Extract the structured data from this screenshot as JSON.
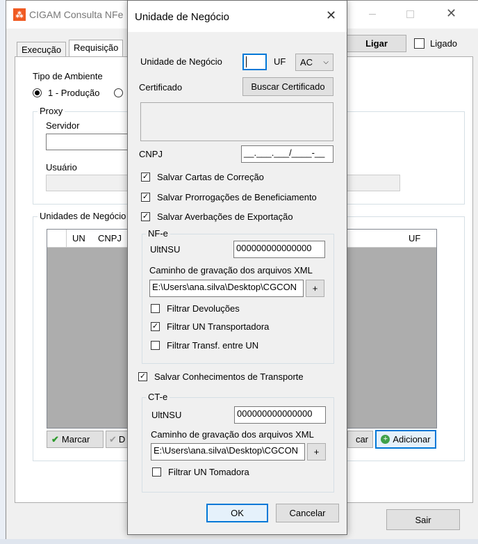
{
  "main_window": {
    "title": "CIGAM Consulta NFe",
    "tabs": [
      "Execução",
      "Requisição"
    ],
    "ligar_label": "Ligar",
    "ligado_label": "Ligado",
    "tipo_ambiente_label": "Tipo de Ambiente",
    "ambiente_option": "1 - Produção",
    "proxy_label": "Proxy",
    "servidor_label": "Servidor",
    "usuario_label": "Usuário",
    "unidades_label": "Unidades de Negócio",
    "grid_columns": [
      "UN",
      "CNPJ",
      "UF"
    ],
    "marcar_label": "Marcar",
    "desmarcar_partial": "D",
    "excluir_partial": "car",
    "adicionar_label": "Adicionar",
    "sair_label": "Sair"
  },
  "dialog": {
    "title": "Unidade de Negócio",
    "unidade_label": "Unidade de Negócio",
    "unidade_value": "",
    "uf_label": "UF",
    "uf_value": "AC",
    "certificado_label": "Certificado",
    "buscar_certificado_label": "Buscar Certificado",
    "cnpj_label": "CNPJ",
    "cnpj_mask": "__.___.___/____-__",
    "checks": [
      {
        "label": "Salvar Cartas de Correção",
        "checked": true
      },
      {
        "label": "Salvar Prorrogações de Beneficiamento",
        "checked": true
      },
      {
        "label": "Salvar Averbações de Exportação",
        "checked": true
      }
    ],
    "nfe": {
      "group_label": "NF-e",
      "ultnsu_label": "UltNSU",
      "ultnsu_value": "000000000000000",
      "path_label": "Caminho de gravação dos arquivos XML",
      "path_value": "E:\\Users\\ana.silva\\Desktop\\CGCON",
      "add_label": "+",
      "filters": [
        {
          "label": "Filtrar Devoluções",
          "checked": false
        },
        {
          "label": "Filtrar UN Transportadora",
          "checked": true
        },
        {
          "label": "Filtrar Transf. entre UN",
          "checked": false
        }
      ]
    },
    "salvar_cte_label": "Salvar Conhecimentos de Transporte",
    "salvar_cte_checked": true,
    "cte": {
      "group_label": "CT-e",
      "ultnsu_label": "UltNSU",
      "ultnsu_value": "000000000000000",
      "path_label": "Caminho de gravação dos arquivos XML",
      "path_value": "E:\\Users\\ana.silva\\Desktop\\CGCON",
      "add_label": "+",
      "filter_label": "Filtrar UN Tomadora",
      "filter_checked": false
    },
    "ok_label": "OK",
    "cancel_label": "Cancelar"
  }
}
